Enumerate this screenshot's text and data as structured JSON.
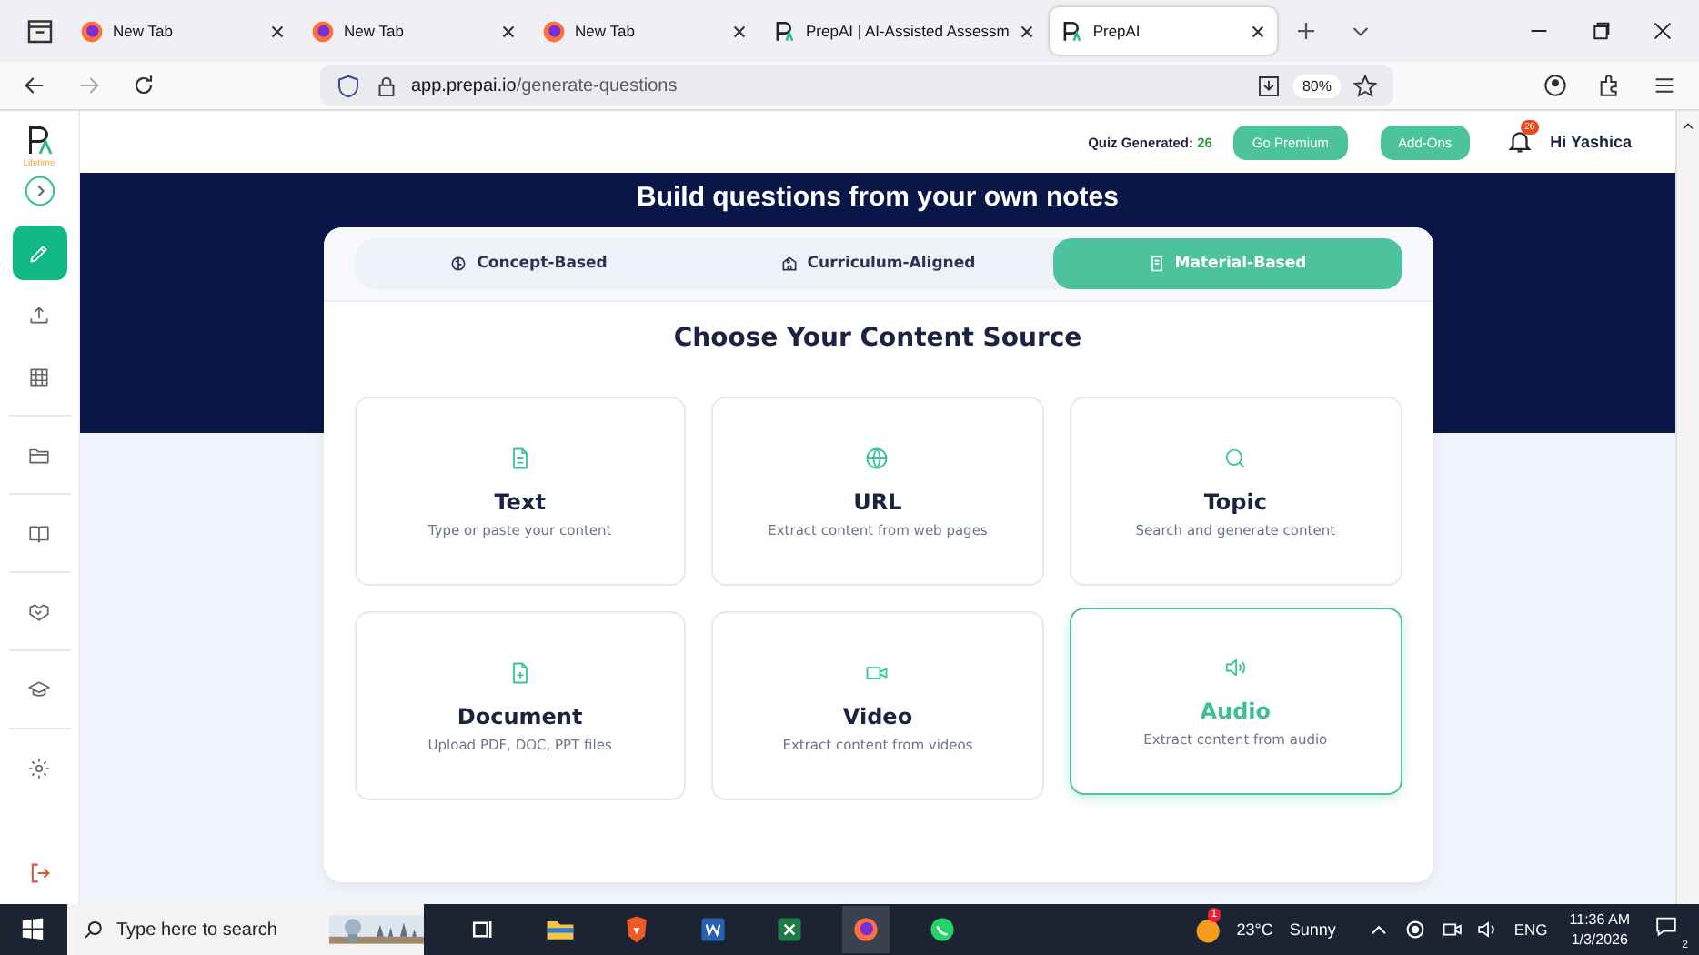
{
  "browser": {
    "tabs": [
      {
        "title": "New Tab",
        "kind": "firefox",
        "selected": false
      },
      {
        "title": "New Tab",
        "kind": "firefox",
        "selected": false
      },
      {
        "title": "New Tab",
        "kind": "firefox",
        "selected": false
      },
      {
        "title": "PrepAI | AI-Assisted Assessm",
        "kind": "prepai",
        "selected": false
      },
      {
        "title": "PrepAI",
        "kind": "prepai",
        "selected": true
      }
    ],
    "url_host": "app.prepai.io",
    "url_path": "/generate-questions",
    "zoom": "80%"
  },
  "sidebar": {
    "plan": "Lifetime",
    "items": [
      {
        "kind": "pencil",
        "selected": true
      },
      {
        "kind": "upload",
        "selected": false
      },
      {
        "kind": "grid",
        "selected": false
      },
      {
        "kind": "folder",
        "selected": false
      },
      {
        "kind": "book",
        "selected": false
      },
      {
        "kind": "handshake",
        "selected": false
      },
      {
        "kind": "cap",
        "selected": false
      },
      {
        "kind": "gear",
        "selected": false
      }
    ]
  },
  "header": {
    "quiz_label": "Quiz Generated:",
    "quiz_count": "26",
    "buttons": [
      "Go Premium",
      "Add-Ons"
    ],
    "notifications": "26",
    "greeting": "Hi Yashica"
  },
  "hero": {
    "title": "Build questions from your own notes"
  },
  "modes": [
    {
      "label": "Concept-Based",
      "selected": false
    },
    {
      "label": "Curriculum-Aligned",
      "selected": false
    },
    {
      "label": "Material-Based",
      "selected": true
    }
  ],
  "section_title": "Choose Your Content Source",
  "sources": [
    {
      "kind": "text",
      "title": "Text",
      "description": "Type or paste your content",
      "selected": false
    },
    {
      "kind": "url",
      "title": "URL",
      "description": "Extract content from web pages",
      "selected": false
    },
    {
      "kind": "topic",
      "title": "Topic",
      "description": "Search and generate content",
      "selected": false
    },
    {
      "kind": "document",
      "title": "Document",
      "description": "Upload PDF, DOC, PPT files",
      "selected": false
    },
    {
      "kind": "video",
      "title": "Video",
      "description": "Extract content from videos",
      "selected": false
    },
    {
      "kind": "audio",
      "title": "Audio",
      "description": "Extract content from audio",
      "selected": true
    }
  ],
  "taskbar": {
    "search_placeholder": "Type here to search",
    "weather_alert": "1",
    "temperature": "23°C",
    "weather": "Sunny",
    "language": "ENG",
    "time": "11:36 AM",
    "date": "1/3/2026",
    "notifications": "2"
  }
}
